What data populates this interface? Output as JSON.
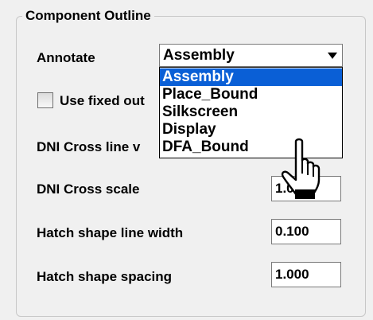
{
  "group": {
    "title": "Component Outline"
  },
  "annotate": {
    "label": "Annotate",
    "selected": "Assembly",
    "options": [
      "Assembly",
      "Place_Bound",
      "Silkscreen",
      "Display",
      "DFA_Bound"
    ]
  },
  "fixed_outline": {
    "label": "Use fixed out",
    "checked": false
  },
  "dni_cross_line": {
    "label": "DNI Cross line v"
  },
  "dni_cross_scale": {
    "label": "DNI Cross scale",
    "value": "1.0"
  },
  "hatch_line_width": {
    "label": "Hatch shape line width",
    "value": "0.100"
  },
  "hatch_spacing": {
    "label": "Hatch shape spacing",
    "value": "1.000"
  },
  "colors": {
    "selection": "#0a5fd6",
    "panel": "#f0f0f0"
  },
  "cursor": {
    "icon": "hand-pointer-icon"
  }
}
